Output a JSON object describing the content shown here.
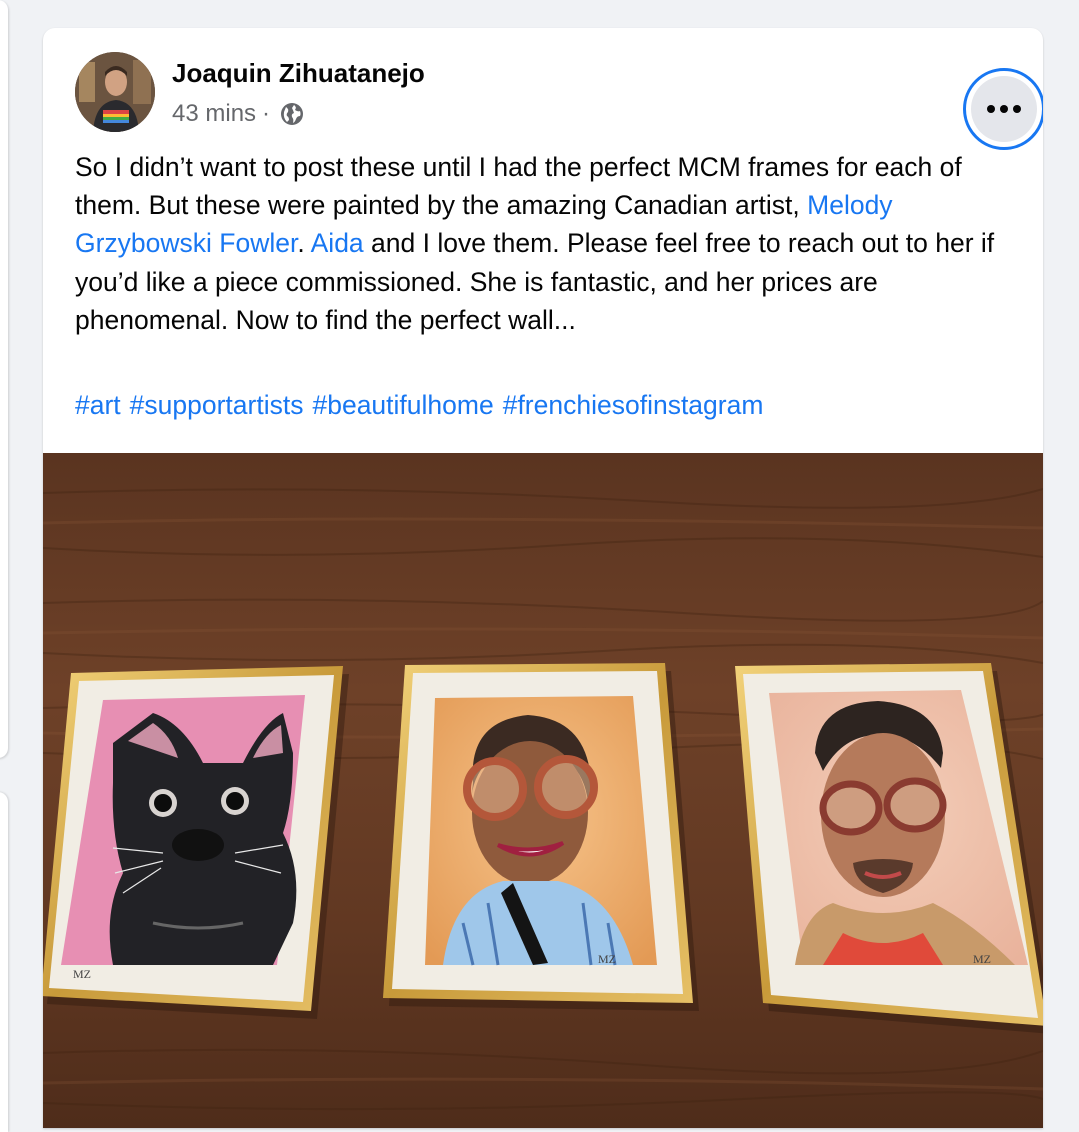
{
  "post": {
    "author": "Joaquin Zihuatanejo",
    "timestamp": "43 mins",
    "separator": "·",
    "audience_icon": "globe-icon",
    "more_icon": "more-dots-icon",
    "text": {
      "part1": "So I didn’t want to post these until I had the perfect MCM frames for each of them. But these were painted by the amazing Canadian artist, ",
      "mention1": "Melody Grzybowski Fowler",
      "part2": ". ",
      "mention2": "Aida",
      "part3": " and I love them. Please feel free to reach out to her if you’d like a piece commissioned. She is fantastic, and her prices are phenomenal. Now to find the perfect wall..."
    },
    "hashtags": [
      "#art",
      "#supportartists",
      "#beautifulhome",
      "#frenchiesofinstagram"
    ]
  },
  "colors": {
    "link": "#1877f2",
    "text": "#050505",
    "meta": "#65676b",
    "background": "#f0f2f5"
  }
}
